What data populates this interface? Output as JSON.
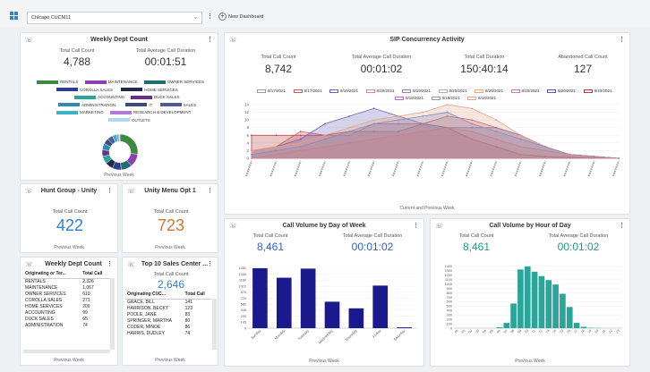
{
  "topbar": {
    "dashboard_select": "Chicago CUCM11",
    "new_dashboard": "New Dashboard"
  },
  "weekly_dept": {
    "title": "Weekly Dept Count",
    "total_label": "Total Call Count",
    "total_value": "4,788",
    "avg_label": "Total Average Call Duration",
    "avg_value": "00:01:51",
    "legend": [
      {
        "name": "RENTALS",
        "color": "#3b8a3e"
      },
      {
        "name": "MAINTENANCE",
        "color": "#8a3fb3"
      },
      {
        "name": "OWNER SERVICES",
        "color": "#1d6f6f"
      },
      {
        "name": "COROLLA SALES",
        "color": "#2c3e8c"
      },
      {
        "name": "HOME SERVICES",
        "color": "#1f2a4a"
      },
      {
        "name": "ACCOUNTING",
        "color": "#2aa59a"
      },
      {
        "name": "DUCK SALES",
        "color": "#6a2f8a"
      },
      {
        "name": "ADMINISTRATION",
        "color": "#2f8ab0"
      },
      {
        "name": "IT",
        "color": "#3a4d7a"
      },
      {
        "name": "SALES",
        "color": "#4a5c9a"
      },
      {
        "name": "MARKETING",
        "color": "#3ab3c7"
      },
      {
        "name": "RESEARCH & DEVELOPMENT",
        "color": "#b07ad6"
      },
      {
        "name": "OUTLETS",
        "color": "#b5d6f0"
      }
    ],
    "donut": [
      {
        "v": 27,
        "color": "#3b8a3e"
      },
      {
        "v": 12,
        "color": "#8a3fb3"
      },
      {
        "v": 10,
        "color": "#1d6f6f"
      },
      {
        "v": 8,
        "color": "#2c3e8c"
      },
      {
        "v": 7,
        "color": "#1f2a4a"
      },
      {
        "v": 7,
        "color": "#2aa59a"
      },
      {
        "v": 6,
        "color": "#6a2f8a"
      },
      {
        "v": 6,
        "color": "#2f8ab0"
      },
      {
        "v": 5,
        "color": "#3a4d7a"
      },
      {
        "v": 5,
        "color": "#4a5c9a"
      },
      {
        "v": 4,
        "color": "#3ab3c7"
      },
      {
        "v": 2,
        "color": "#b07ad6"
      },
      {
        "v": 1,
        "color": "#b5d6f0"
      }
    ],
    "footer": "Previous Week"
  },
  "sip": {
    "title": "SIP Concurrency Activity",
    "metrics": [
      {
        "label": "Total Call Count",
        "value": "8,742"
      },
      {
        "label": "Total Average Call Duration",
        "value": "00:01:02"
      },
      {
        "label": "Total Call Duration",
        "value": "150:40:14"
      },
      {
        "label": "Abandoned Call Count",
        "value": "127"
      }
    ],
    "legend_row1": [
      "8/17/2021",
      "8/17/2021",
      "8/19/2021",
      "8/19/2021",
      "8/19/2021",
      "8/20/2021",
      "8/20/2021",
      "8/20/2021",
      "8/20/2021",
      "8/20/2021"
    ],
    "legend_row2": [
      "8/18/2021",
      "8/18/2021",
      "8/18/2021"
    ],
    "footer": "Current and Previous Week"
  },
  "hunt": {
    "title": "Hunt Group - Unity",
    "label": "Total Call Count",
    "value": "422",
    "footer": "Previous Week"
  },
  "unity": {
    "title": "Unity Menu Opt 1",
    "label": "Total Call Count",
    "value": "723",
    "footer": "Previous Week"
  },
  "weekly_table": {
    "title": "Weekly Dept Count",
    "headers": [
      "Originating or Ter...",
      "Total Call"
    ],
    "rows": [
      [
        "RENTALS",
        "2,326"
      ],
      [
        "MAINTENANCE",
        "1,067"
      ],
      [
        "OWNER SERVICES",
        "610"
      ],
      [
        "COROLLA SALES",
        "271"
      ],
      [
        "HOME SERVICES",
        "209"
      ],
      [
        "ACCOUNTING",
        "99"
      ],
      [
        "DUCK SALES",
        "65"
      ],
      [
        "ADMINISTRATION",
        "74"
      ]
    ],
    "footer": "Previous Week"
  },
  "top10": {
    "title": "Top 10 Sales Center ...",
    "label": "Total Call Count",
    "value": "2,646",
    "headers": [
      "Originating CUC...",
      "Total Call"
    ],
    "rows": [
      [
        "GRACE, BILL",
        "141"
      ],
      [
        "HARRISON, BECKY",
        "123"
      ],
      [
        "POOLE, JANE",
        "83"
      ],
      [
        "SPRINGER, MARTHA",
        "80"
      ],
      [
        "CODER, MINOE",
        "86"
      ],
      [
        "HARRIS, DUDLEY",
        "74"
      ]
    ],
    "footer": "Previous Week"
  },
  "dow": {
    "title": "Call Volume by Day of Week",
    "total_label": "Total Call Count",
    "total_value": "8,461",
    "avg_label": "Total Average Call Duration",
    "avg_value": "00:01:02",
    "footer": "Previous Week"
  },
  "hod": {
    "title": "Call Volume by Hour of Day",
    "total_label": "Total Call Count",
    "total_value": "8,461",
    "avg_label": "Total Average Call Duration",
    "avg_value": "00:01:02",
    "footer": "Previous Week"
  },
  "chart_data": [
    {
      "type": "area",
      "title": "SIP Concurrency Activity",
      "ylim": [
        0,
        14
      ],
      "yticks": [
        0,
        2,
        4,
        6,
        8,
        10,
        12,
        14
      ],
      "series": [
        {
          "color": "#b23b3b",
          "values": [
            6,
            6,
            6,
            6,
            7,
            7,
            7,
            9,
            8,
            5,
            3,
            1,
            0.5,
            0.3,
            0.1,
            0
          ]
        },
        {
          "color": "#c45a5a",
          "values": [
            2,
            3,
            7,
            6,
            6,
            9,
            9,
            9,
            11,
            10,
            8,
            6,
            3,
            1,
            0.5,
            0
          ]
        },
        {
          "color": "#6b63b5",
          "values": [
            2,
            3,
            5,
            9,
            11,
            13,
            11,
            9,
            8,
            8,
            8,
            6,
            3,
            1,
            0.5,
            0
          ]
        },
        {
          "color": "#e0a48a",
          "values": [
            2,
            3,
            4,
            6,
            8,
            10,
            11,
            12,
            14,
            13,
            10,
            6,
            3,
            1,
            0.5,
            0
          ]
        },
        {
          "color": "#8a8ab8",
          "values": [
            1,
            2,
            3,
            5,
            7,
            9,
            10,
            11,
            12,
            9,
            7,
            5,
            3,
            1,
            0.5,
            0
          ]
        },
        {
          "color": "#c98282",
          "values": [
            0,
            1,
            2,
            3,
            4,
            5,
            6,
            7,
            8,
            7,
            5,
            3,
            2,
            1,
            0.5,
            0
          ]
        }
      ]
    },
    {
      "type": "bar",
      "title": "Call Volume by Day of Week",
      "categories": [
        "Sunday",
        "Monday",
        "Tuesday",
        "Wednesday",
        "Thursday",
        "Friday",
        "Saturday"
      ],
      "values": [
        1450,
        1220,
        1440,
        640,
        480,
        1030,
        20
      ],
      "yticks": [
        0,
        145,
        290,
        435,
        580,
        725,
        870,
        1015,
        1160,
        1305,
        1450
      ],
      "ylim": [
        0,
        1600
      ],
      "color": "#1a1a8c"
    },
    {
      "type": "bar",
      "title": "Call Volume by Hour of Day",
      "categories": [
        "00",
        "01",
        "02",
        "03",
        "04",
        "05",
        "06",
        "07",
        "08",
        "09",
        "10",
        "11",
        "12",
        "13",
        "14",
        "15",
        "16",
        "17",
        "18",
        "19",
        "20",
        "21",
        "22",
        "23"
      ],
      "values": [
        0,
        0,
        0,
        0,
        0,
        0,
        20,
        120,
        560,
        1330,
        1400,
        1280,
        1180,
        1090,
        990,
        780,
        480,
        120,
        30,
        10,
        5,
        0,
        0,
        0
      ],
      "yticks": [
        0,
        100,
        200,
        300,
        400,
        500,
        600,
        700,
        800,
        900,
        1000,
        1100,
        1200,
        1300,
        1400
      ],
      "ylim": [
        0,
        1500
      ],
      "color": "#2aa59a"
    }
  ]
}
